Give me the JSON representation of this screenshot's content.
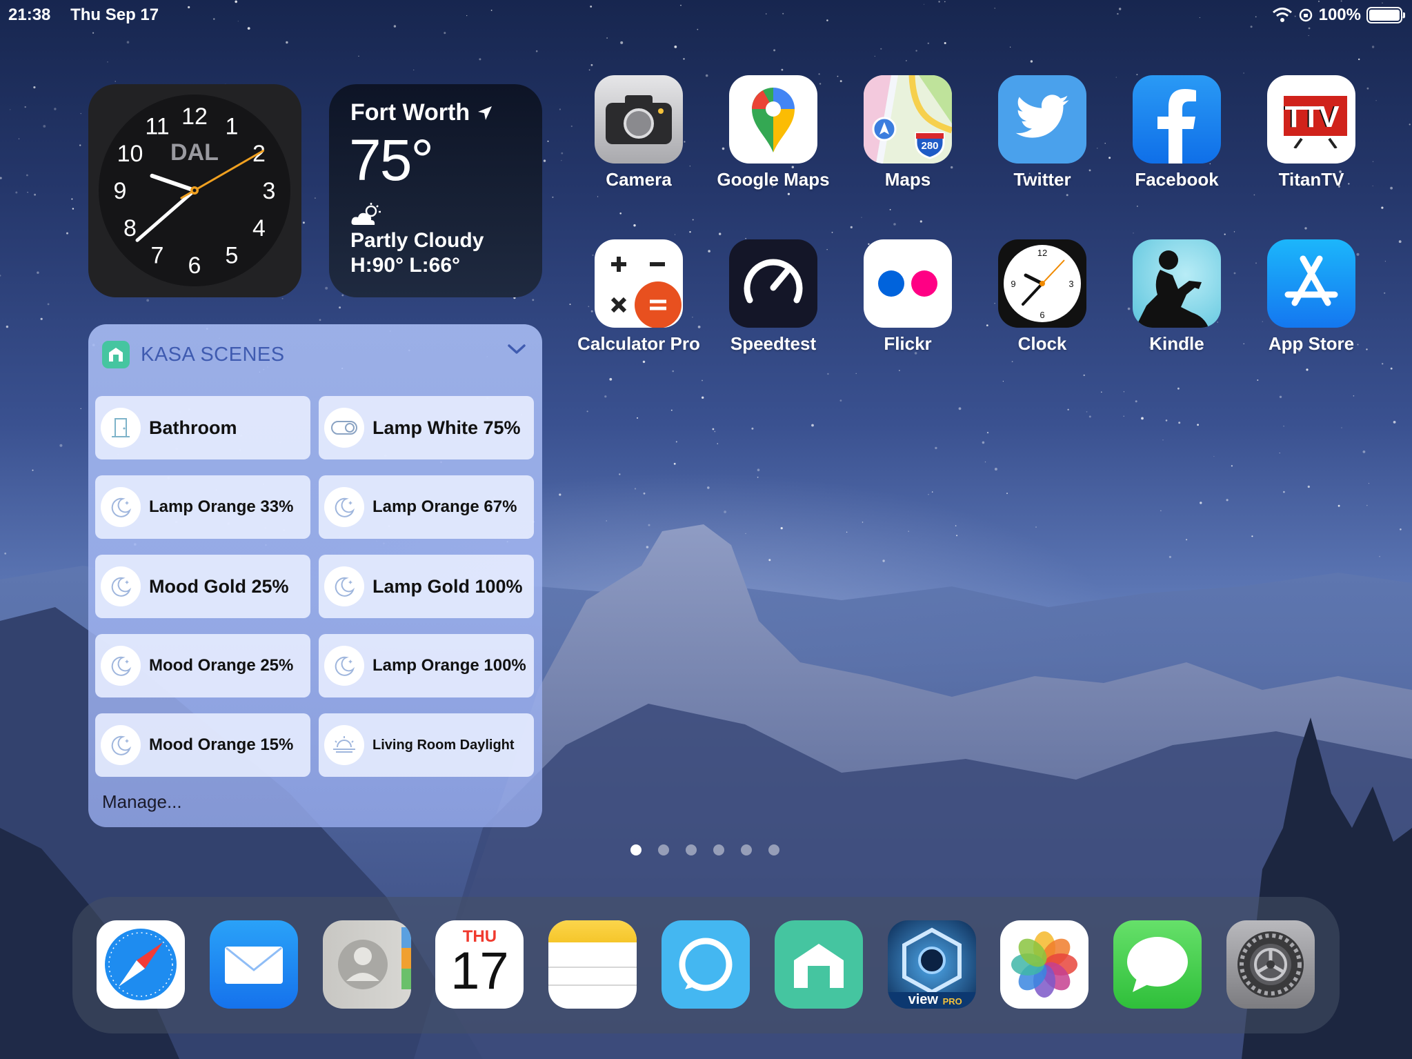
{
  "status_bar": {
    "time": "21:38",
    "date": "Thu Sep 17",
    "battery": "100%"
  },
  "clock_widget": {
    "city": "DAL",
    "numerals": [
      "12",
      "1",
      "2",
      "3",
      "4",
      "5",
      "6",
      "7",
      "8",
      "9",
      "10",
      "11"
    ],
    "hour": 21,
    "minute": 38,
    "second": 10
  },
  "weather_widget": {
    "city": "Fort Worth",
    "temperature": "75°",
    "condition": "Partly Cloudy",
    "hi_lo": "H:90° L:66°"
  },
  "kasa_widget": {
    "title": "KASA SCENES",
    "manage_label": "Manage...",
    "scenes": [
      {
        "label": "Bathroom",
        "icon": "door-icon"
      },
      {
        "label": "Lamp White 75%",
        "icon": "toggle-icon"
      },
      {
        "label": "Lamp Orange 33%",
        "icon": "moon-icon"
      },
      {
        "label": "Lamp Orange 67%",
        "icon": "moon-icon"
      },
      {
        "label": "Mood Gold 25%",
        "icon": "moon-icon"
      },
      {
        "label": "Lamp Gold 100%",
        "icon": "moon-icon"
      },
      {
        "label": "Mood Orange 25%",
        "icon": "moon-icon"
      },
      {
        "label": "Lamp Orange 100%",
        "icon": "moon-icon"
      },
      {
        "label": "Mood Orange 15%",
        "icon": "moon-icon"
      },
      {
        "label": "Living Room Daylight",
        "icon": "sunrise-icon"
      }
    ]
  },
  "apps": [
    {
      "label": "Camera",
      "icon": "camera-icon"
    },
    {
      "label": "Google Maps",
      "icon": "google-maps-icon"
    },
    {
      "label": "Maps",
      "icon": "maps-icon"
    },
    {
      "label": "Twitter",
      "icon": "twitter-icon"
    },
    {
      "label": "Facebook",
      "icon": "facebook-icon"
    },
    {
      "label": "TitanTV",
      "icon": "titantv-icon"
    },
    {
      "label": "Calculator Pro",
      "icon": "calculator-icon"
    },
    {
      "label": "Speedtest",
      "icon": "speedtest-icon"
    },
    {
      "label": "Flickr",
      "icon": "flickr-icon"
    },
    {
      "label": "Clock",
      "icon": "clock-icon"
    },
    {
      "label": "Kindle",
      "icon": "kindle-icon"
    },
    {
      "label": "App Store",
      "icon": "app-store-icon"
    }
  ],
  "app_icon_text": {
    "maps_shield": "280",
    "titantv_logo": "TTV"
  },
  "page_dots": {
    "count": 6,
    "active": 1
  },
  "dock": {
    "calendar_day": "THU",
    "calendar_date": "17",
    "viewpro_text": "view",
    "viewpro_badge": "PRO",
    "items": [
      {
        "icon": "safari-icon"
      },
      {
        "icon": "mail-icon"
      },
      {
        "icon": "contacts-icon"
      },
      {
        "icon": "calendar-icon"
      },
      {
        "icon": "notes-icon"
      },
      {
        "icon": "alexa-icon"
      },
      {
        "icon": "kasa-icon"
      },
      {
        "icon": "viewpro-icon"
      },
      {
        "icon": "photos-icon"
      },
      {
        "icon": "messages-icon"
      },
      {
        "icon": "settings-icon"
      }
    ]
  },
  "colors": {
    "kasa_title": "#3f5bb0",
    "kasa_green": "#45c5a0",
    "clock_orange": "#f0a020"
  }
}
